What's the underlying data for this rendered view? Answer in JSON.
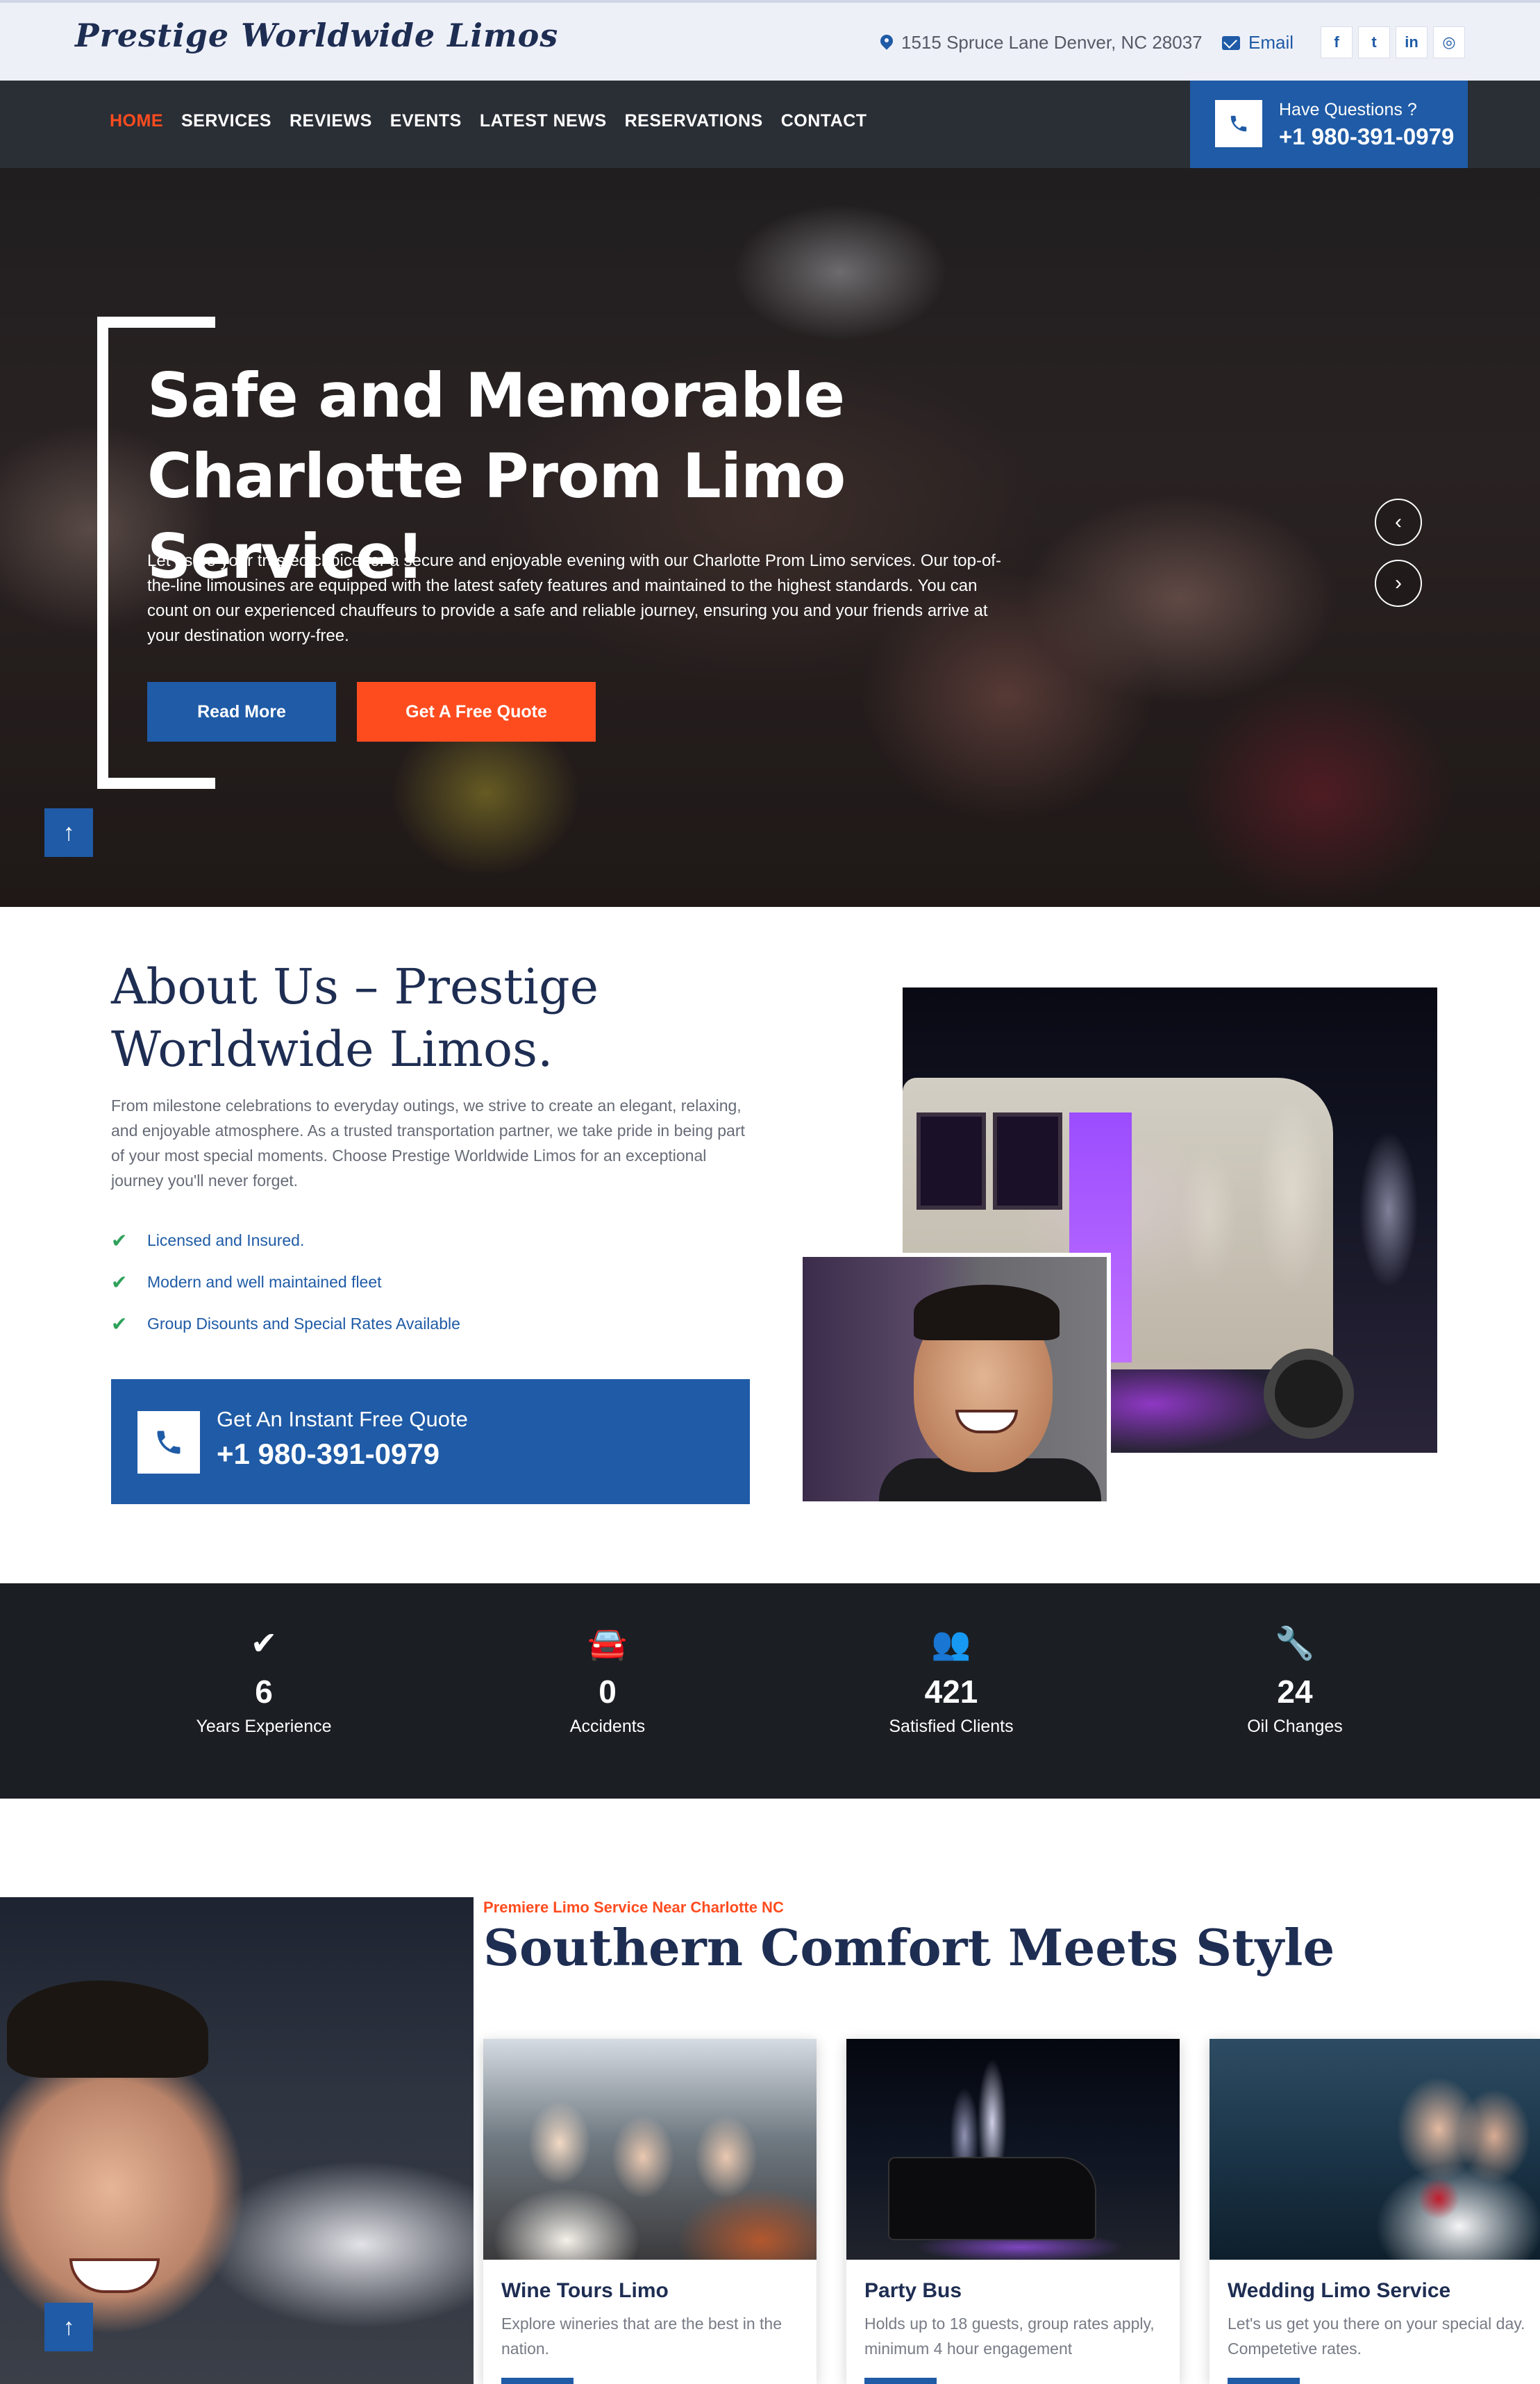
{
  "brand": "Prestige Worldwide Limos",
  "topbar": {
    "address": "1515 Spruce Lane Denver, NC 28037",
    "email_label": "Email",
    "socials": [
      {
        "icon": "facebook-icon",
        "glyph": "f"
      },
      {
        "icon": "twitter-icon",
        "glyph": "t"
      },
      {
        "icon": "linkedin-icon",
        "glyph": "in"
      },
      {
        "icon": "instagram-icon",
        "glyph": "◎"
      }
    ]
  },
  "nav": {
    "items": [
      "HOME",
      "SERVICES",
      "REVIEWS",
      "EVENTS",
      "LATEST NEWS",
      "RESERVATIONS",
      "CONTACT"
    ],
    "active": "HOME"
  },
  "questions": {
    "label": "Have Questions ?",
    "phone": "+1 980-391-0979"
  },
  "hero": {
    "title": "Safe and Memorable Charlotte Prom Limo Service!",
    "text": "Let us be your trusted choice for a secure and enjoyable evening with our Charlotte Prom Limo services. Our top-of-the-line limousines are equipped with the latest safety features and maintained to the highest standards. You can count on our experienced chauffeurs to provide a safe and reliable journey, ensuring you and your friends arrive at your destination worry-free.",
    "read_more": "Read More",
    "free_quote": "Get A Free Quote",
    "prev_icon": "‹",
    "next_icon": "›"
  },
  "about": {
    "title": "About Us – Prestige Worldwide Limos.",
    "text": "From milestone celebrations to everyday outings, we strive to create an elegant, relaxing, and enjoyable atmosphere. As a trusted transportation partner, we take pride in being part of your most special moments. Choose Prestige Worldwide Limos for an exceptional journey you'll never forget.",
    "checklist": [
      "Licensed and Insured.",
      "Modern and well maintained fleet",
      "Group Disounts and Special Rates Available"
    ],
    "quote_label": "Get An Instant Free Quote",
    "quote_phone": "+1 980-391-0979"
  },
  "stats": [
    {
      "icon": "check-icon",
      "glyph": "✔",
      "value": "6",
      "label": "Years Experience"
    },
    {
      "icon": "car-crash-icon",
      "glyph": "🚘",
      "value": "0",
      "label": "Accidents"
    },
    {
      "icon": "users-icon",
      "glyph": "👥",
      "value": "421",
      "label": "Satisfied Clients"
    },
    {
      "icon": "wrench-icon",
      "glyph": "🔧",
      "value": "24",
      "label": "Oil Changes"
    }
  ],
  "services": {
    "kicker": "Premiere Limo Service Near Charlotte NC",
    "title": "Southern Comfort Meets Style",
    "cards": [
      {
        "title": "Wine Tours Limo",
        "text": "Explore wineries that are the best in the nation."
      },
      {
        "title": "Party Bus",
        "text": "Holds up to 18 guests, group rates apply, minimum 4 hour engagement"
      },
      {
        "title": "Wedding Limo Service",
        "text": "Let's us get you there on your special day. Competetive rates."
      }
    ]
  },
  "scroll_top_icon": "↑",
  "colors": {
    "primary": "#1f5ba6",
    "accent": "#ff4c1f",
    "navy": "#1e2d52",
    "dark": "#1b1f24"
  }
}
